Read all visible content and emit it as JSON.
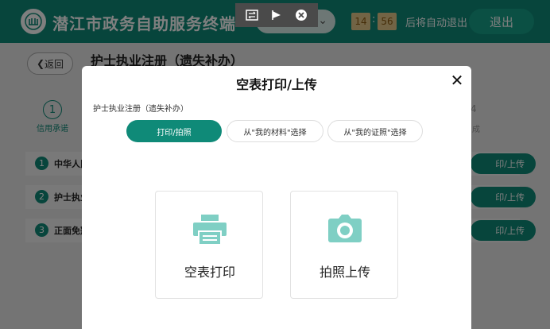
{
  "header": {
    "title": "潜江市政务自助服务终端",
    "time_minutes": "14",
    "time_seconds": "56",
    "time_separator": ":",
    "auto_exit_text": "后将自动退出",
    "exit_label": "退出",
    "brand_color": "#0f8a78"
  },
  "toolbar": {
    "icons": [
      "switch-icon",
      "flag-icon",
      "close-circle-icon"
    ]
  },
  "page": {
    "back_label": "返回",
    "title": "护士执业注册（遗失补办）",
    "steps": [
      {
        "number": "1",
        "label": "信用承诺"
      },
      {
        "number": "4",
        "label": "成"
      }
    ],
    "rows": [
      {
        "number": "1",
        "text": "中华人民",
        "button": "印/上传"
      },
      {
        "number": "2",
        "text": "护士执业",
        "button": "印/上传"
      },
      {
        "number": "3",
        "text": "正面免冠",
        "button": "印/上传"
      }
    ]
  },
  "modal": {
    "title": "空表打印/上传",
    "subtitle": "护士执业注册（遗失补办）",
    "tabs": [
      {
        "label": "打印/拍照",
        "active": true
      },
      {
        "label": "从\"我的材料\"选择",
        "active": false
      },
      {
        "label": "从\"我的证照\"选择",
        "active": false
      }
    ],
    "cards": [
      {
        "label": "空表打印",
        "icon": "printer-icon"
      },
      {
        "label": "拍照上传",
        "icon": "camera-icon"
      }
    ],
    "icon_color": "#7fcfc4"
  }
}
